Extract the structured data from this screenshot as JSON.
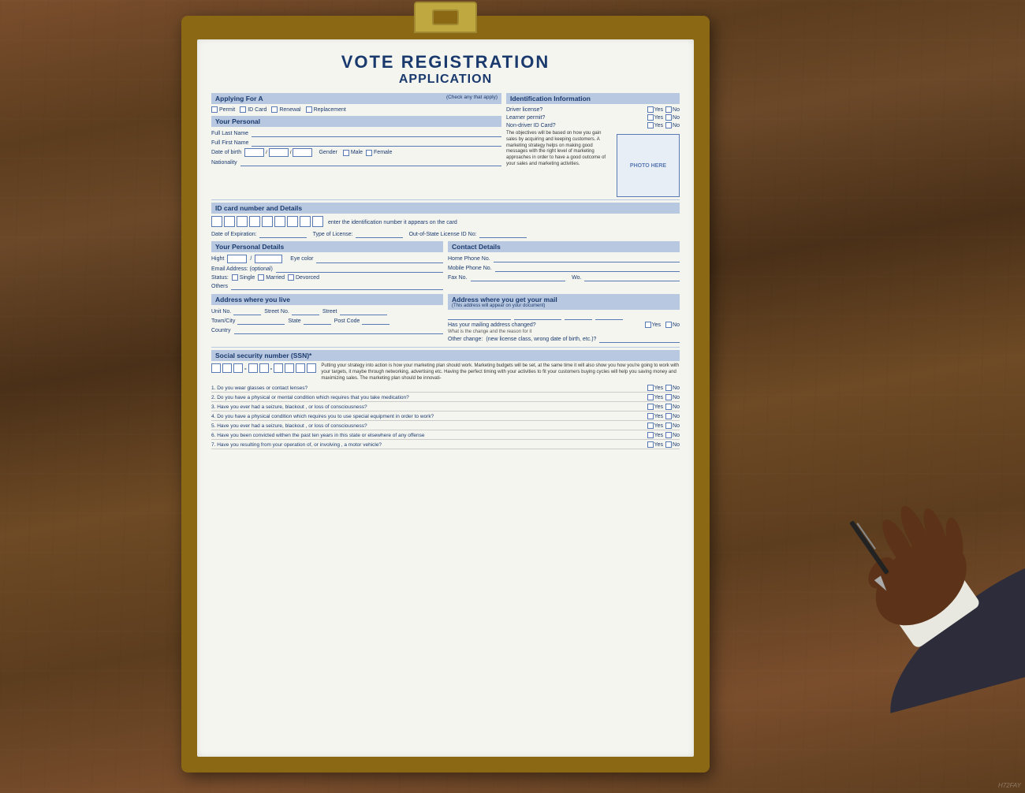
{
  "background": {
    "color": "#5c3d1e"
  },
  "form": {
    "title": "VOTE REGISTRATION",
    "subtitle": "APPLICATION",
    "sections": {
      "applying_for": {
        "label": "Applying For A",
        "note": "(Check any that apply)",
        "options": [
          "Permit",
          "ID Card",
          "Renewal",
          "Replacement"
        ]
      },
      "identification_info": {
        "label": "Identification Information",
        "fields": [
          {
            "label": "Driver license?",
            "yn": true
          },
          {
            "label": "Learner permit?",
            "yn": true
          },
          {
            "label": "Non-driver ID Card?",
            "yn": true
          }
        ],
        "photo_label": "PHOTO HERE",
        "body_text": "The objectives will be based on how you gain sales by acquiring and keeping customers. A marketing strategy helps on making good messages with the right level of marketing approaches in order to have a good outcome of your sales and marketing activities."
      },
      "your_personal": {
        "label": "Your Personal",
        "fields": [
          "Full Last Name",
          "Full First Name",
          "Date of birth",
          "Gender",
          "Nationality"
        ],
        "gender_options": [
          "Male",
          "Female"
        ]
      },
      "id_card": {
        "label": "ID card number and Details",
        "hint": "enter the identification number it appears on the card",
        "sub_fields": [
          "Date of Expiration:",
          "Type of License:",
          "Out-of-State License ID No:"
        ]
      },
      "personal_details": {
        "label": "Your Personal Details",
        "fields": [
          {
            "label": "Hight"
          },
          {
            "label": "Eye color"
          },
          {
            "label": "Email Address: (optional)"
          },
          {
            "label": "Status:",
            "options": [
              "Single",
              "Married",
              "Devorced"
            ]
          },
          {
            "label": "Others"
          }
        ]
      },
      "contact_details": {
        "label": "Contact Details",
        "fields": [
          "Home Phone No.",
          "Mobile Phone No.",
          "Fax No.",
          "Wo."
        ]
      },
      "address_live": {
        "label": "Address where you live",
        "fields": [
          {
            "label": "Unit No."
          },
          {
            "label": "Street No."
          },
          {
            "label": "Street"
          },
          {
            "label": "Town/City"
          },
          {
            "label": "State"
          },
          {
            "label": "Post Code"
          },
          {
            "label": "Country"
          }
        ]
      },
      "address_mail": {
        "label": "Address where you get your mail",
        "note": "(This address will appear on your document)",
        "mailing_changed": "Has your mailing address changed?",
        "other_change_label": "Other change:",
        "other_change_note": "(new license class, wrong date of birth, etc.)?",
        "what_change": "What is the change and the reason for it"
      },
      "ssn": {
        "label": "Social security number (SSN)*",
        "body_text": "Putting your strategy into action is how your marketing plan should work. Marketing budgets will be set, at the same time it will also show you how you're going to work with your targets, it maybe through networking, advertising etc. Having the perfect timing with your activities to fit your customers buying cycles will help you saving money and maximizing sales. The marketing plan should be innovati-"
      },
      "questions": {
        "items": [
          "1.  Do you wear glasses or contact lenses?",
          "2.  Do you have a physical or mental condition which requires that you take medication?",
          "3.  Have you ever had a seizure, blackout , or loss of consciousness?",
          "4.  Do you have a physical condition which requires you to use special equipment in order to work?",
          "5.  Have you ever had a seizure, blackout , or loss of consciousness?",
          "6.  Have you been convicted withen the past ten years in this state or elsewhere of any offense",
          "7.  Have you resulting from your operation of, or involving , a motor vehicle?"
        ]
      }
    }
  },
  "watermark": {
    "text": "H72FAY"
  }
}
